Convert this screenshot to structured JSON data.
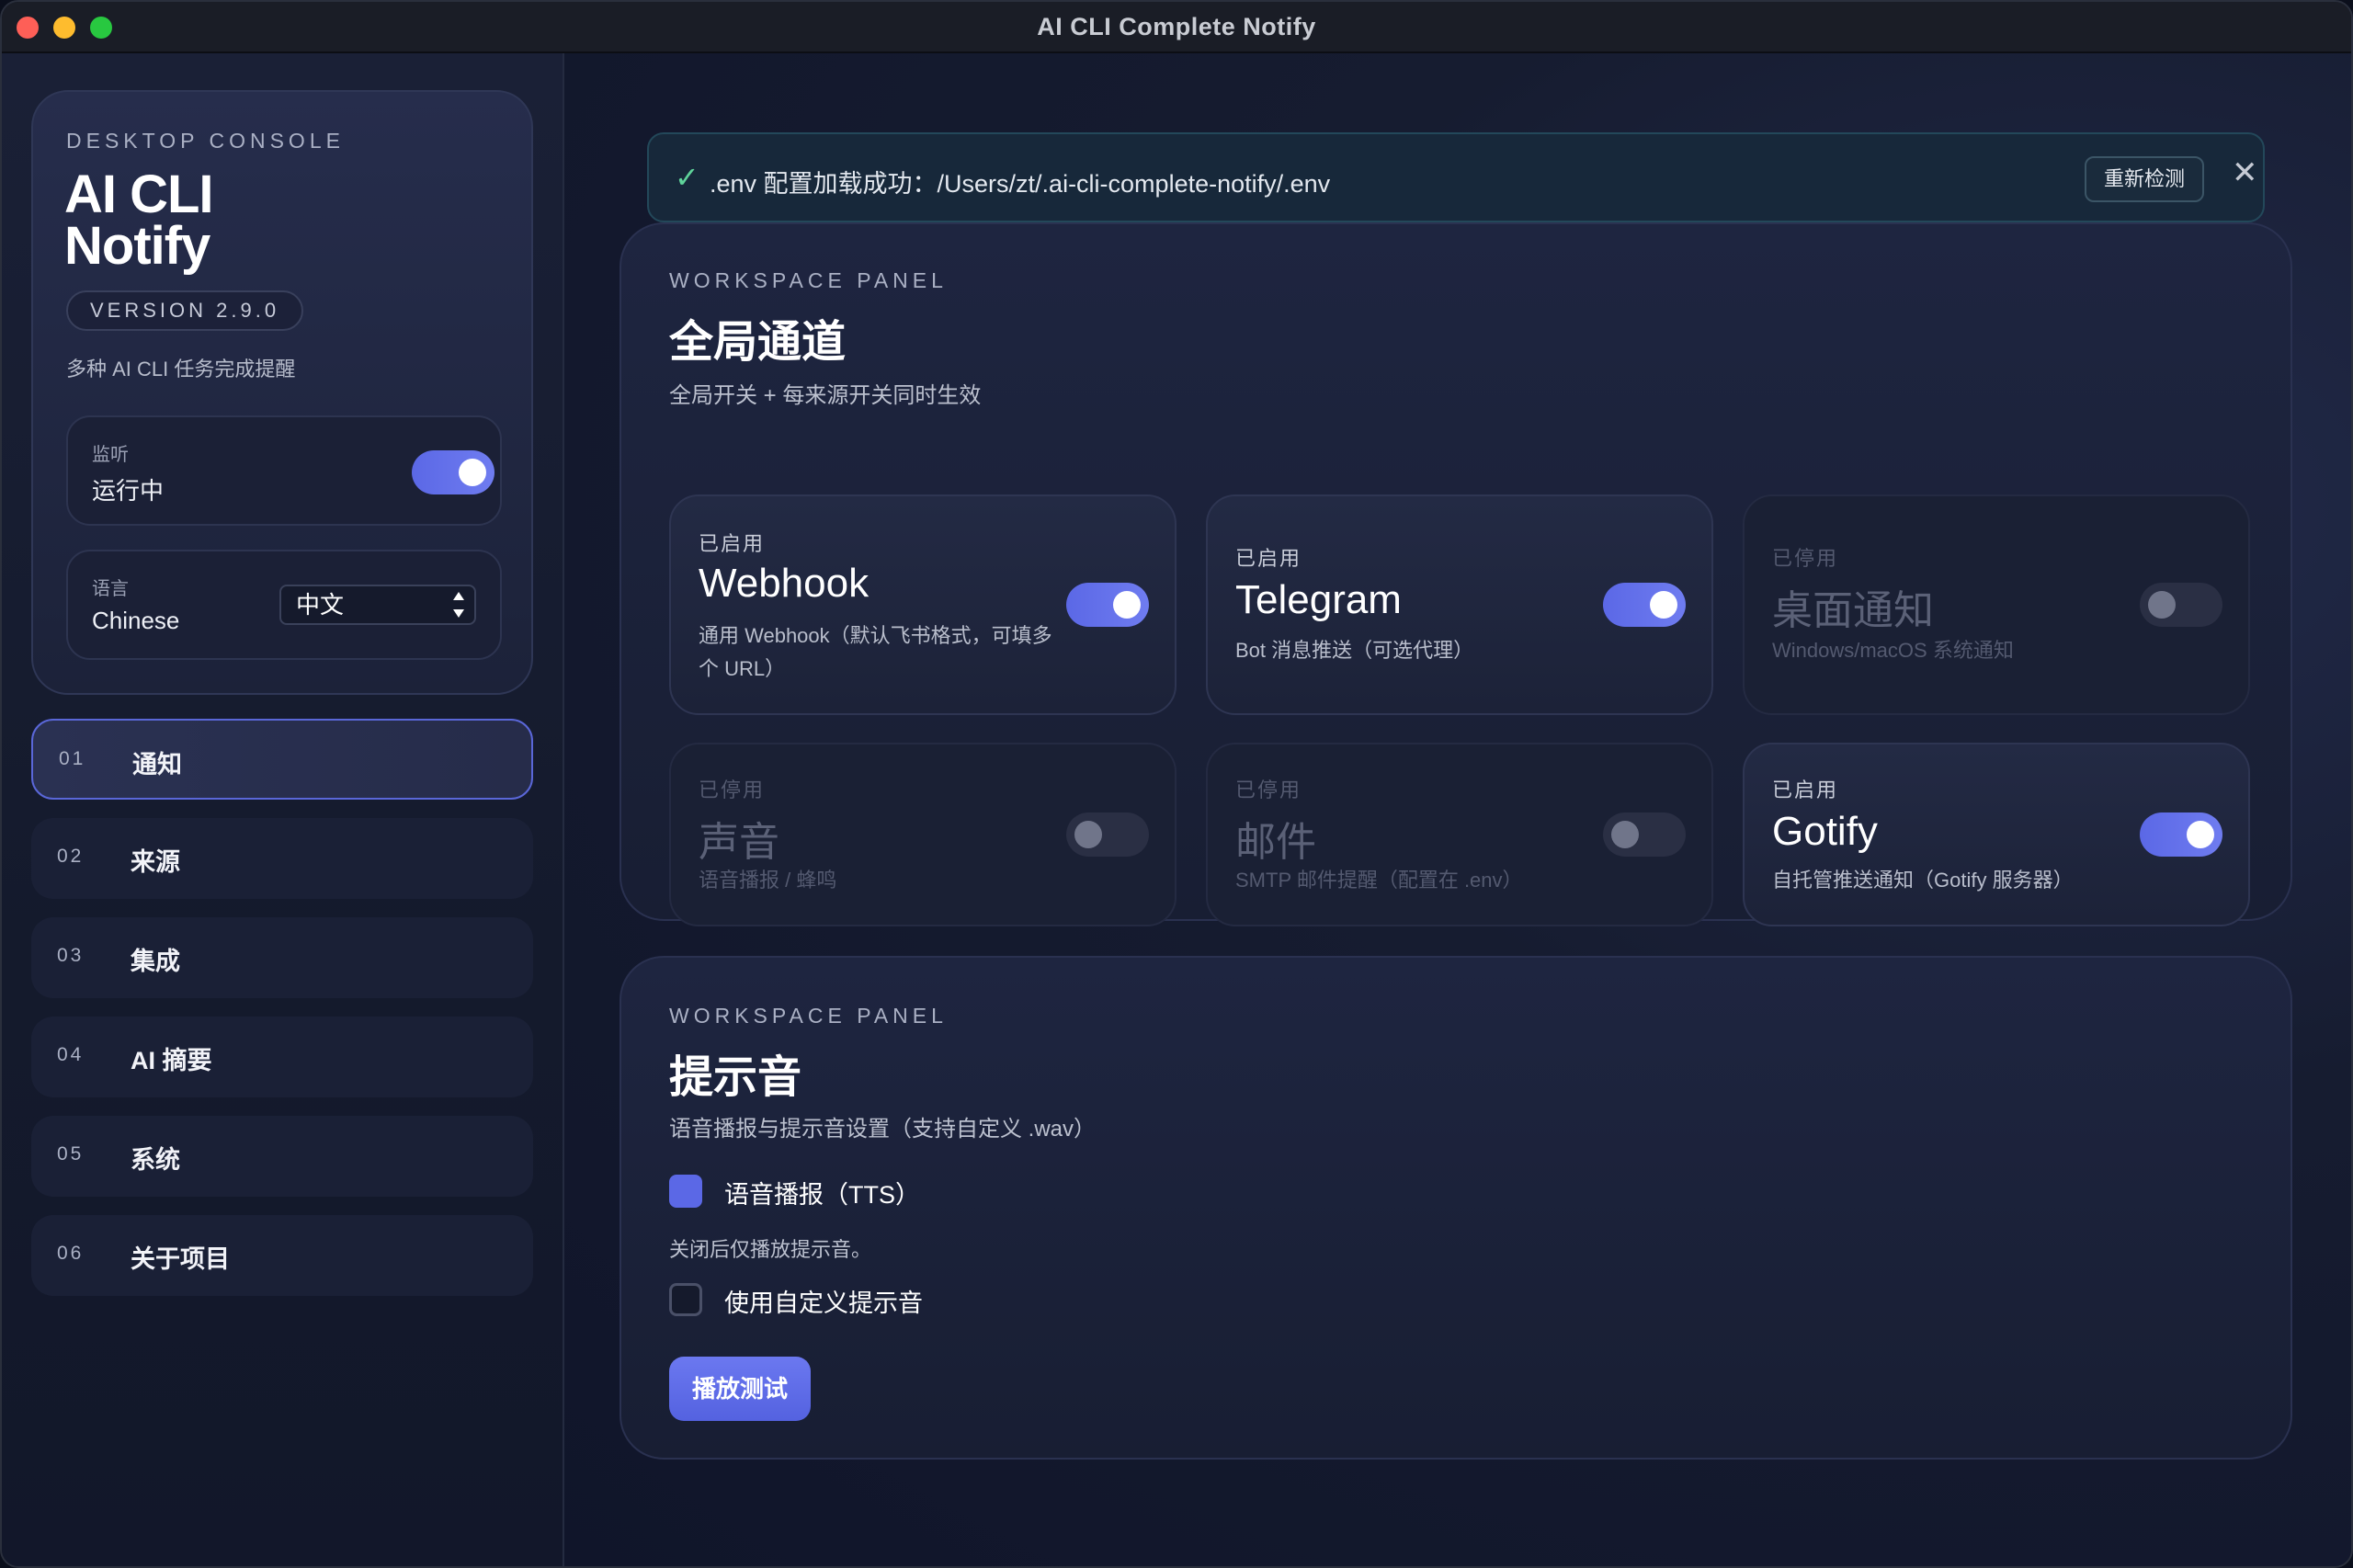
{
  "window": {
    "title": "AI CLI Complete Notify"
  },
  "brand": {
    "eyebrow": "DESKTOP CONSOLE",
    "title_line1": "AI CLI",
    "title_line2": "Notify",
    "version": "VERSION 2.9.0",
    "description": "多种 AI CLI 任务完成提醒"
  },
  "monitor": {
    "label": "监听",
    "value": "运行中",
    "enabled": true
  },
  "language": {
    "label": "语言",
    "value": "Chinese",
    "selected": "中文"
  },
  "nav": [
    {
      "num": "01",
      "label": "通知",
      "active": true
    },
    {
      "num": "02",
      "label": "来源"
    },
    {
      "num": "03",
      "label": "集成"
    },
    {
      "num": "04",
      "label": "AI 摘要"
    },
    {
      "num": "05",
      "label": "系统"
    },
    {
      "num": "06",
      "label": "关于项目"
    }
  ],
  "banner": {
    "check": "✓",
    "text": ".env 配置加载成功：/Users/zt/.ai-cli-complete-notify/.env",
    "button": "重新检测",
    "close": "✕"
  },
  "channels_panel": {
    "eyebrow": "WORKSPACE PANEL",
    "title": "全局通道",
    "subtitle": "全局开关 + 每来源开关同时生效",
    "channels": [
      {
        "status": "已启用",
        "name": "Webhook",
        "desc": "通用 Webhook（默认飞书格式，可填多个 URL）",
        "enabled": true
      },
      {
        "status": "已启用",
        "name": "Telegram",
        "desc": "Bot 消息推送（可选代理）",
        "enabled": true
      },
      {
        "status": "已停用",
        "name": "桌面通知",
        "desc": "Windows/macOS 系统通知",
        "enabled": false
      },
      {
        "status": "已停用",
        "name": "声音",
        "desc": "语音播报 / 蜂鸣",
        "enabled": false
      },
      {
        "status": "已停用",
        "name": "邮件",
        "desc": "SMTP 邮件提醒（配置在 .env）",
        "enabled": false
      },
      {
        "status": "已启用",
        "name": "Gotify",
        "desc": "自托管推送通知（Gotify 服务器）",
        "enabled": true
      }
    ]
  },
  "sound_panel": {
    "eyebrow": "WORKSPACE PANEL",
    "title": "提示音",
    "subtitle": "语音播报与提示音设置（支持自定义 .wav）",
    "tts_label": "语音播报（TTS）",
    "tts_checked": true,
    "tts_hint": "关闭后仅播放提示音。",
    "custom_label": "使用自定义提示音",
    "custom_checked": false,
    "play_button": "播放测试"
  },
  "colors": {
    "accent": "#5b68e6",
    "success": "#5fd39a"
  }
}
